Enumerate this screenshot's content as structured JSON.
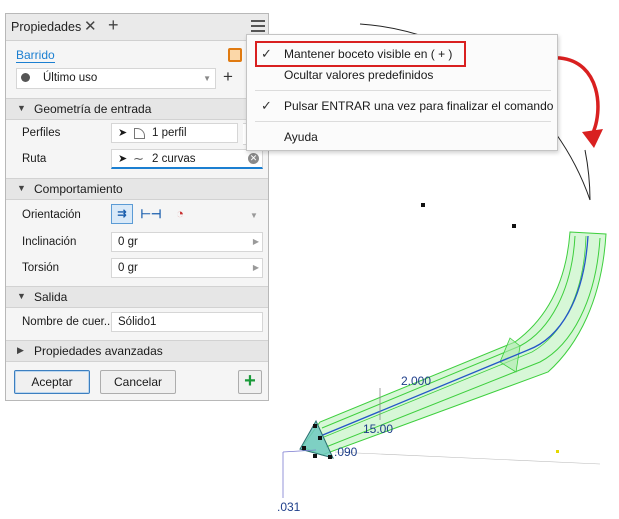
{
  "panel": {
    "title": "Propiedades",
    "close_glyph": "✕",
    "add_glyph": "+",
    "feature_link": "Barrido",
    "preset": {
      "value": "Último uso"
    },
    "sections": {
      "input_geometry": "Geometría de entrada",
      "behavior": "Comportamiento",
      "output": "Salida",
      "advanced": "Propiedades avanzadas"
    },
    "profiles": {
      "label": "Perfiles",
      "value": "1 perfil"
    },
    "path": {
      "label": "Ruta",
      "value": "2 curvas"
    },
    "orientation": {
      "label": "Orientación"
    },
    "taper": {
      "label": "Inclinación",
      "value": "0 gr"
    },
    "twist": {
      "label": "Torsión",
      "value": "0 gr"
    },
    "body_name": {
      "label": "Nombre de cuer...",
      "value": "Sólido1"
    },
    "ok_label": "Aceptar",
    "cancel_label": "Cancelar",
    "plus_glyph": "+"
  },
  "menu": {
    "items": [
      {
        "label": "Mantener boceto visible en ( + )",
        "checked": true
      },
      {
        "label": "Ocultar valores predefinidos",
        "checked": false
      },
      {
        "label": "Pulsar ENTRAR una vez para finalizar el comando",
        "checked": true
      },
      {
        "label": "Ayuda",
        "checked": false
      }
    ],
    "check_glyph": "✓"
  },
  "viewport": {
    "dimensions": [
      "2.000",
      "15.00",
      ".090",
      ".031"
    ]
  },
  "colors": {
    "accent": "#1b7fd1",
    "highlight_border": "#d92020",
    "sweep_fill": "#8ee08e",
    "sweep_edge": "#3ecf3e",
    "dimension_text": "#1f3f8a",
    "add_button": "#1a9a3a"
  }
}
